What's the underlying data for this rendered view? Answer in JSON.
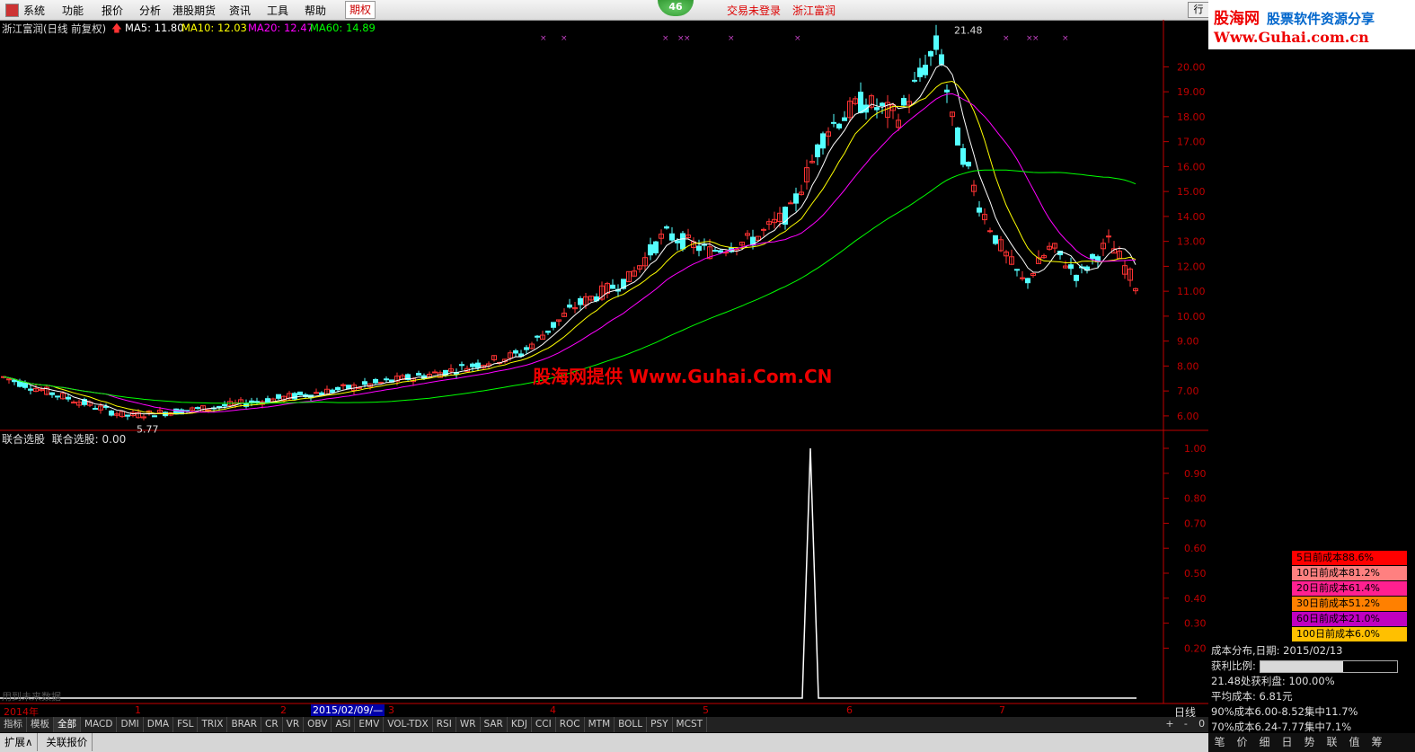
{
  "menu": {
    "items": [
      "系统",
      "功能",
      "报价",
      "分析",
      "港股期货",
      "资讯",
      "工具",
      "帮助",
      "期权"
    ],
    "badge": "46",
    "login_status": "交易未登录",
    "stock_name": "浙江富润",
    "right_button": "行"
  },
  "brand": {
    "name": "股海网",
    "slogan": "股票软件资源分享",
    "url": "Www.Guhai.com.cn"
  },
  "legend": {
    "title": "浙江富润(日线 前复权)",
    "ma5": "MA5: 11.80",
    "ma10": "MA10: 12.03",
    "ma20": "MA20: 12.47",
    "ma60": "MA60: 14.89"
  },
  "colors": {
    "ma5": "#ffffff",
    "ma10": "#ffff00",
    "ma20": "#ff00ff",
    "ma60": "#00ff00",
    "up": "#ff3333",
    "down": "#54ffff",
    "axis": "#c00000"
  },
  "price_labels": {
    "high": "21.48",
    "low": "5.77"
  },
  "watermark": "股海网提供 Www.Guhai.Com.CN",
  "subchart": {
    "title": "联合选股",
    "value_label": "联合选股: 0.00",
    "future_note": "用到未来数据"
  },
  "chart_data": {
    "type": "candlestick",
    "price_axis": {
      "ticks": [
        "20.00",
        "19.00",
        "18.00",
        "17.00",
        "16.00",
        "15.00",
        "14.00",
        "13.00",
        "12.00",
        "11.00",
        "10.00",
        "9.00",
        "8.00",
        "7.00",
        "6.00"
      ],
      "range": [
        5.6,
        21.6
      ]
    },
    "sub_axis": {
      "ticks": [
        "1.00",
        "0.90",
        "0.80",
        "0.70",
        "0.60",
        "0.50",
        "0.40",
        "0.30",
        "0.20"
      ],
      "range": [
        0,
        1.0
      ]
    },
    "signal": {
      "date": "2015/05 (approx)",
      "value": 1.0
    },
    "ma_last": {
      "MA5": 11.8,
      "MA10": 12.03,
      "MA20": 12.47,
      "MA60": 14.89
    },
    "high": 21.48,
    "low": 5.77
  },
  "date_axis": {
    "labels": [
      "2014年",
      "1",
      "2",
      "3",
      "4",
      "5",
      "6",
      "7"
    ],
    "cursor": "2015/02/09/—",
    "period": "日线"
  },
  "indicators": [
    "指标",
    "模板",
    "全部",
    "MACD",
    "DMI",
    "DMA",
    "FSL",
    "TRIX",
    "BRAR",
    "CR",
    "VR",
    "OBV",
    "ASI",
    "EMV",
    "VOL-TDX",
    "RSI",
    "WR",
    "SAR",
    "KDJ",
    "CCI",
    "ROC",
    "MTM",
    "BOLL",
    "PSY",
    "MCST"
  ],
  "controls": [
    "+",
    "-",
    "0"
  ],
  "bottom_tabs": [
    "扩展∧",
    "关联报价"
  ],
  "side_tabs": [
    "笔",
    "价",
    "细",
    "日",
    "势",
    "联",
    "值",
    "筹"
  ],
  "cost_legend": [
    {
      "label": "5日前成本88.6%",
      "color": "#ff0000"
    },
    {
      "label": "10日前成本81.2%",
      "color": "#ff8080"
    },
    {
      "label": "20日前成本61.4%",
      "color": "#ff2090"
    },
    {
      "label": "30日前成本51.2%",
      "color": "#ff8000"
    },
    {
      "label": "60日前成本21.0%",
      "color": "#c000c0"
    },
    {
      "label": "100日前成本6.0%",
      "color": "#ffc000"
    }
  ],
  "cost_info": {
    "date_line": "成本分布,日期: 2015/02/13",
    "profit_label": "获利比例:",
    "profit_value": "60.7%",
    "profit_fraction": 0.607,
    "at_price": "21.48处获利盘: 100.00%",
    "avg_cost": "平均成本: 6.81元",
    "c90": "90%成本6.00-8.52集中11.7%",
    "c70": "70%成本6.24-7.77集中7.1%"
  }
}
